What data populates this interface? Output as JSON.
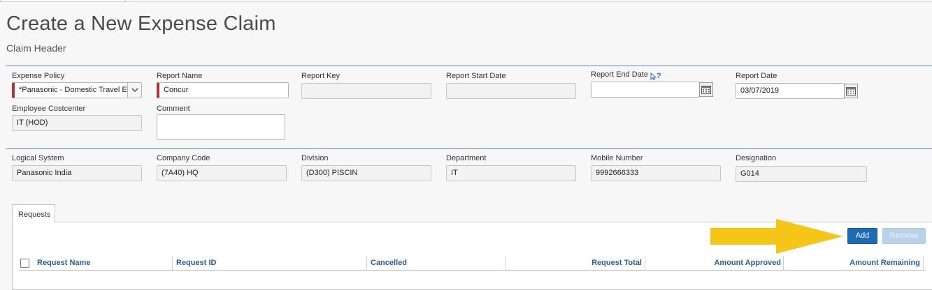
{
  "page": {
    "title": "Create a New Expense Claim",
    "subtitle": "Claim Header"
  },
  "header_fields": {
    "expense_policy": {
      "label": "Expense Policy",
      "value": "*Panasonic - Domestic Travel E"
    },
    "report_name": {
      "label": "Report Name",
      "value": "Concur"
    },
    "report_key": {
      "label": "Report Key",
      "value": ""
    },
    "report_start_date": {
      "label": "Report Start Date",
      "value": ""
    },
    "report_end_date": {
      "label": "Report End Date",
      "help": "?",
      "value": ""
    },
    "report_date": {
      "label": "Report Date",
      "value": "03/07/2019"
    },
    "employee_costcenter": {
      "label": "Employee Costcenter",
      "value": "IT (HOD)"
    },
    "comment": {
      "label": "Comment",
      "value": ""
    }
  },
  "org_fields": {
    "logical_system": {
      "label": "Logical System",
      "value": "Panasonic India"
    },
    "company_code": {
      "label": "Company Code",
      "value": "(7A40) HQ"
    },
    "division": {
      "label": "Division",
      "value": "(D300) PISCIN"
    },
    "department": {
      "label": "Department",
      "value": "IT"
    },
    "mobile_number": {
      "label": "Mobile Number",
      "value": "9992666333"
    },
    "designation": {
      "label": "Designation",
      "value": "G014"
    }
  },
  "requests": {
    "tab_label": "Requests",
    "add_label": "Add",
    "remove_label": "Remove",
    "columns": [
      "Request Name",
      "Request ID",
      "Cancelled",
      "Request Total",
      "Amount Approved",
      "Amount Remaining"
    ]
  },
  "colors": {
    "accent": "#1d6bb3",
    "required_marker": "#b0323a",
    "annotation_arrow": "#f5c518"
  },
  "icons": {
    "calendar": "calendar-icon",
    "dropdown": "chevron-down-icon",
    "help": "help-icon",
    "arrow": "arrow-right-icon"
  }
}
